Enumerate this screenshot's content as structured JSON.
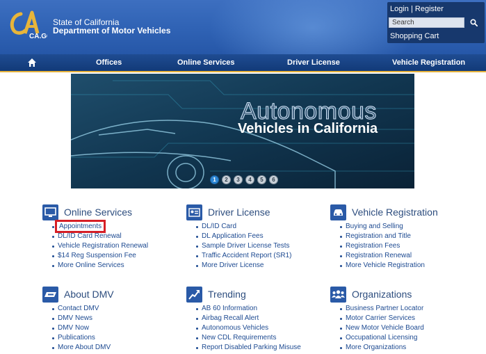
{
  "header": {
    "logo_text": "CA.GOV",
    "state_title": "State of California",
    "dept_title": "Department of Motor Vehicles"
  },
  "account": {
    "login": "Login",
    "separator": "|",
    "register": "Register",
    "search_placeholder": "Search",
    "shopping_cart": "Shopping Cart"
  },
  "nav": {
    "home_icon": "home-icon",
    "items": [
      "Offices",
      "Online Services",
      "Driver License",
      "Vehicle Registration"
    ]
  },
  "banner": {
    "title1": "Autonomous",
    "title2": "Vehicles in California",
    "slides": [
      "1",
      "2",
      "3",
      "4",
      "5",
      "6"
    ],
    "active_slide": "1"
  },
  "sections": [
    {
      "title": "Online Services",
      "icon": "monitor-icon",
      "links": [
        "Appointments",
        "DL/ID Card Renewal",
        "Vehicle Registration Renewal",
        "$14 Reg Suspension Fee",
        "More Online Services"
      ],
      "highlighted": "Appointments"
    },
    {
      "title": "Driver License",
      "icon": "id-card-icon",
      "links": [
        "DL/ID Card",
        "DL Application Fees",
        "Sample Driver License Tests",
        "Traffic Accident Report (SR1)",
        "More Driver License"
      ]
    },
    {
      "title": "Vehicle Registration",
      "icon": "car-icon",
      "links": [
        "Buying and Selling",
        "Registration and Title",
        "Registration Fees",
        "Registration Renewal",
        "More Vehicle Registration"
      ]
    },
    {
      "title": "About DMV",
      "icon": "dmv-logo-icon",
      "links": [
        "Contact DMV",
        "DMV News",
        "DMV Now",
        "Publications",
        "More About DMV"
      ]
    },
    {
      "title": "Trending",
      "icon": "trending-up-icon",
      "links": [
        "AB 60 Information",
        "Airbag Recall Alert",
        "Autonomous Vehicles",
        "New CDL Requirements",
        "Report Disabled Parking Misuse"
      ]
    },
    {
      "title": "Organizations",
      "icon": "people-icon",
      "links": [
        "Business Partner Locator",
        "Motor Carrier Services",
        "New Motor Vehicle Board",
        "Occupational Licensing",
        "More Organizations"
      ]
    }
  ],
  "colors": {
    "header_blue": "#2f62b4",
    "nav_blue": "#123a78",
    "accent_gold": "#e6b23a",
    "link_blue": "#1d4a91",
    "highlight_red": "#d61f26"
  }
}
